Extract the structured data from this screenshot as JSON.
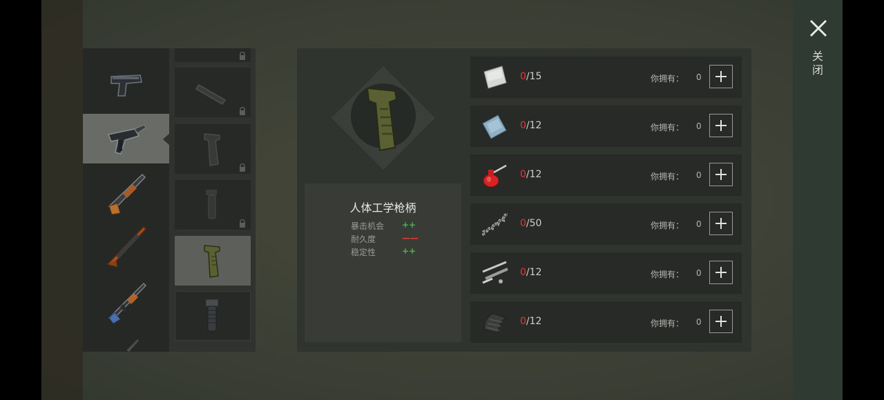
{
  "close": {
    "label_line1": "关",
    "label_line2": "闭"
  },
  "item": {
    "name": "人体工学枪柄",
    "stats": [
      {
        "label": "暴击机会",
        "value": "++",
        "kind": "up"
      },
      {
        "label": "耐久度",
        "value": "——",
        "kind": "down"
      },
      {
        "label": "稳定性",
        "value": "++",
        "kind": "up"
      }
    ]
  },
  "materials": [
    {
      "icon": "metal-sheet-icon",
      "have": "0",
      "need": "/15",
      "owned_label": "你拥有：",
      "owned_value": "0"
    },
    {
      "icon": "blue-metal-plate-icon",
      "have": "0",
      "need": "/12",
      "owned_label": "你拥有：",
      "owned_value": "0"
    },
    {
      "icon": "oil-can-icon",
      "have": "0",
      "need": "/12",
      "owned_label": "你拥有：",
      "owned_value": "0"
    },
    {
      "icon": "spring-icon",
      "have": "0",
      "need": "/50",
      "owned_label": "你拥有：",
      "owned_value": "0"
    },
    {
      "icon": "gun-parts-icon",
      "have": "0",
      "need": "/12",
      "owned_label": "你拥有：",
      "owned_value": "0"
    },
    {
      "icon": "rubber-plate-icon",
      "have": "0",
      "need": "/12",
      "owned_label": "你拥有：",
      "owned_value": "0"
    }
  ],
  "weapons": [
    "pistol-icon",
    "uzi-icon",
    "shotgun-icon",
    "rifle-icon",
    "ak47-icon",
    "weapon-partial-icon"
  ],
  "attachments": [
    {
      "icon": "attachment-partial-icon",
      "locked": true
    },
    {
      "icon": "silencer-icon",
      "locked": true
    },
    {
      "icon": "grip-dim-icon",
      "locked": true
    },
    {
      "icon": "vertical-grip-dim-icon",
      "locked": true
    },
    {
      "icon": "ergonomic-grip-icon",
      "locked": false,
      "selected": true
    },
    {
      "icon": "vertical-grip-icon",
      "locked": false
    }
  ]
}
